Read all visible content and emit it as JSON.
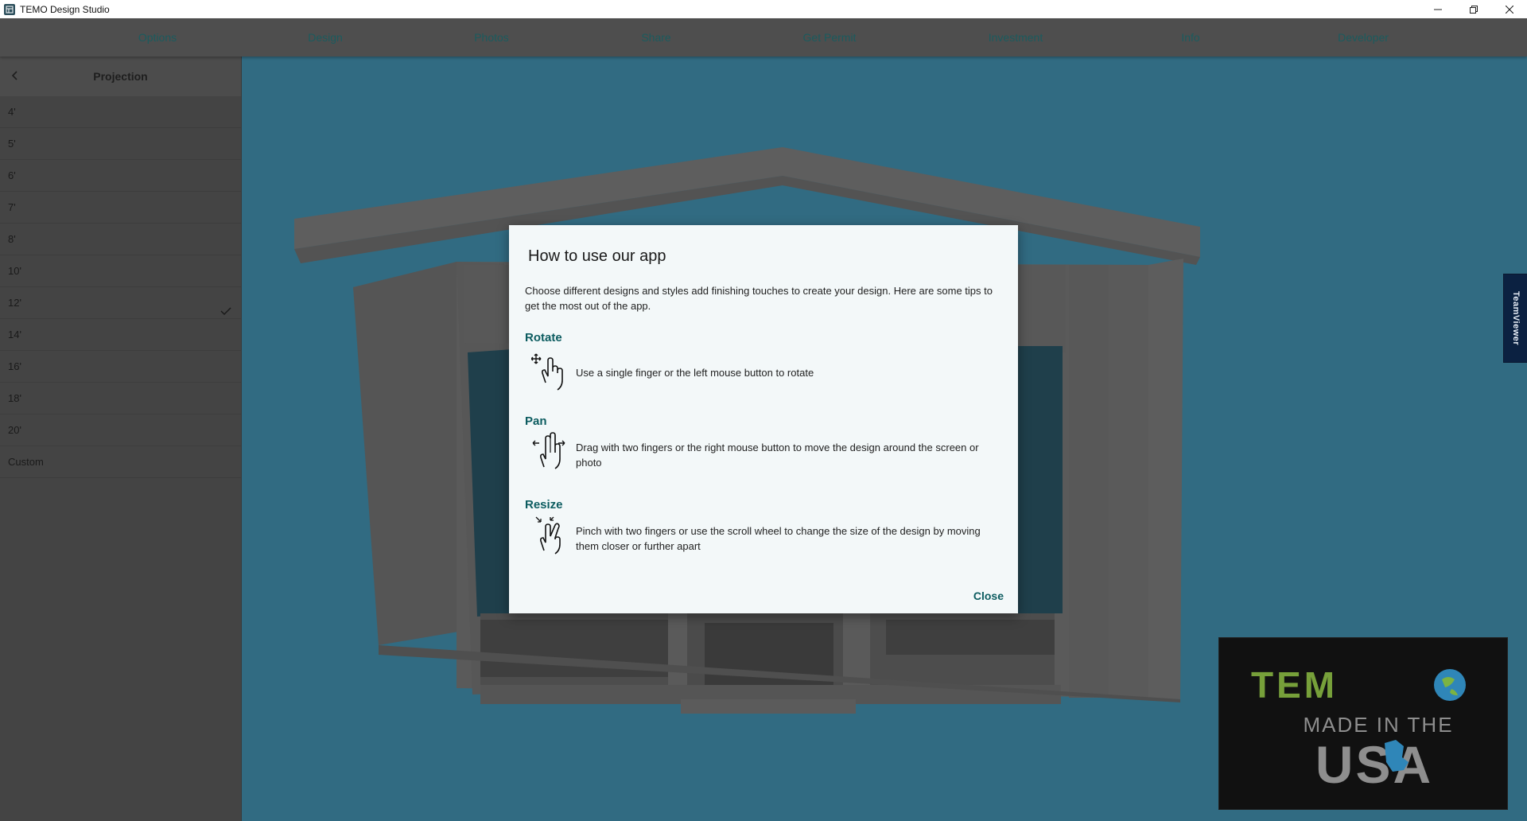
{
  "window": {
    "title": "TEMO Design Studio"
  },
  "nav": {
    "items": [
      "Options",
      "Design",
      "Photos",
      "Share",
      "Get Permit",
      "Investment",
      "Info",
      "Developer"
    ]
  },
  "sidebar": {
    "title": "Projection",
    "items": [
      {
        "label": "4'",
        "selected": false
      },
      {
        "label": "5'",
        "selected": false
      },
      {
        "label": "6'",
        "selected": false
      },
      {
        "label": "7'",
        "selected": false
      },
      {
        "label": "8'",
        "selected": false
      },
      {
        "label": "10'",
        "selected": false
      },
      {
        "label": "12'",
        "selected": true
      },
      {
        "label": "14'",
        "selected": false
      },
      {
        "label": "16'",
        "selected": false
      },
      {
        "label": "18'",
        "selected": false
      },
      {
        "label": "20'",
        "selected": false
      },
      {
        "label": "Custom",
        "selected": false
      }
    ]
  },
  "dialog": {
    "title": "How to use our app",
    "intro": "Choose different designs and styles add finishing touches to create your design. Here are some tips to get the most out of the app.",
    "tips": [
      {
        "heading": "Rotate",
        "text": "Use a single finger or the left mouse button to rotate",
        "icon": "rotate-hand-icon"
      },
      {
        "heading": "Pan",
        "text": "Drag with two fingers or the right mouse button to move the design around the screen or photo",
        "icon": "pan-hand-icon"
      },
      {
        "heading": "Resize",
        "text": "Pinch with two fingers or use the scroll wheel to change the size of the design by moving them closer or further apart",
        "icon": "pinch-hand-icon"
      }
    ],
    "close_label": "Close"
  },
  "teamviewer": {
    "label": "TeamViewer"
  },
  "logo": {
    "brand": "TEMO",
    "tagline_top": "MADE IN THE",
    "tagline_bottom": "USA"
  },
  "colors": {
    "accent": "#0c5c60",
    "nav_text": "#1b5b5e",
    "scene_background": "#316b82",
    "overlay_dim": "#444444"
  }
}
